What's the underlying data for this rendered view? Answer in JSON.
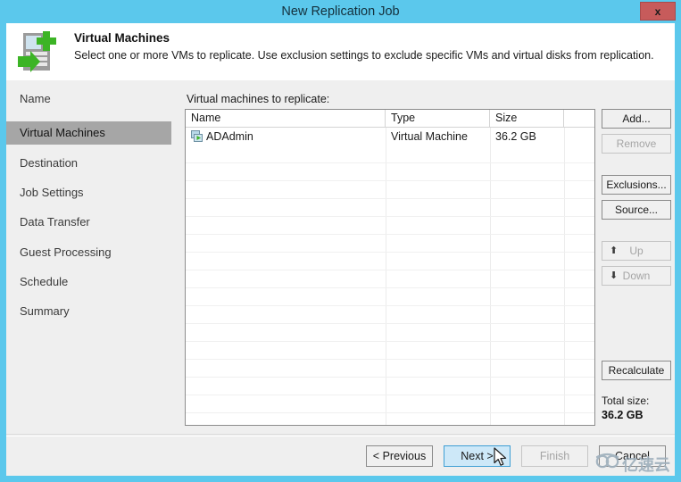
{
  "window": {
    "title": "New Replication Job",
    "close_label": "x",
    "accent_color": "#5bc8ec",
    "close_color": "#c75b5b"
  },
  "header": {
    "icon": "virtual-machine-replicate-icon",
    "title": "Virtual Machines",
    "description": "Select one or more VMs to replicate. Use exclusion settings to exclude specific VMs and virtual disks from replication."
  },
  "sidebar": {
    "items": [
      {
        "label": "Name",
        "selected": false
      },
      {
        "label": "Virtual Machines",
        "selected": true
      },
      {
        "label": "Destination",
        "selected": false
      },
      {
        "label": "Job Settings",
        "selected": false
      },
      {
        "label": "Data Transfer",
        "selected": false
      },
      {
        "label": "Guest Processing",
        "selected": false
      },
      {
        "label": "Schedule",
        "selected": false
      },
      {
        "label": "Summary",
        "selected": false
      }
    ],
    "selected_bg": "#a6a6a6"
  },
  "main": {
    "list_label": "Virtual machines to replicate:",
    "table": {
      "columns": [
        "Name",
        "Type",
        "Size"
      ],
      "rows": [
        {
          "icon": "virtual-machine-icon",
          "name": "ADAdmin",
          "type": "Virtual Machine",
          "size": "36.2 GB"
        }
      ]
    },
    "side_buttons": [
      {
        "label": "Add...",
        "disabled": false,
        "icon": null
      },
      {
        "label": "Remove",
        "disabled": true,
        "icon": null
      },
      {
        "label": "Exclusions...",
        "disabled": false,
        "icon": null
      },
      {
        "label": "Source...",
        "disabled": false,
        "icon": null
      },
      {
        "label": "Up",
        "disabled": true,
        "icon": "arrow-up-icon"
      },
      {
        "label": "Down",
        "disabled": true,
        "icon": "arrow-down-icon"
      },
      {
        "label": "Recalculate",
        "disabled": false,
        "icon": null
      }
    ],
    "total_size_label": "Total size:",
    "total_size_value": "36.2 GB"
  },
  "footer": {
    "buttons": [
      {
        "label": "< Previous",
        "state": "normal"
      },
      {
        "label": "Next >",
        "state": "primary"
      },
      {
        "label": "Finish",
        "state": "disabled"
      },
      {
        "label": "Cancel",
        "state": "normal"
      }
    ]
  },
  "watermark": {
    "text": "亿速云",
    "icon": "cloud-logo-icon"
  }
}
